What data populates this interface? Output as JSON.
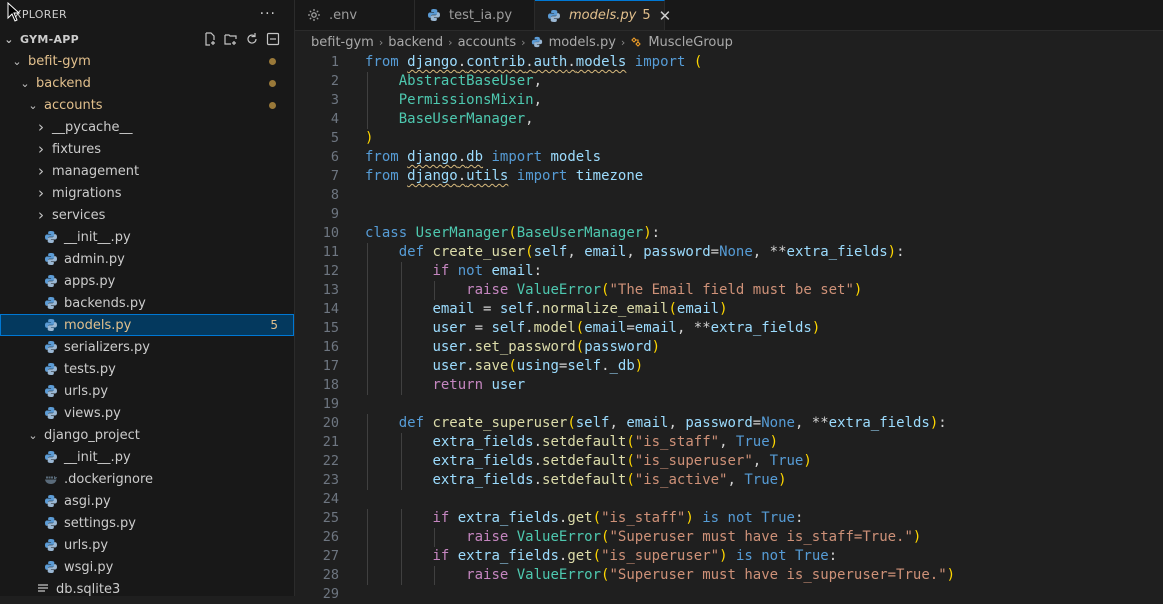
{
  "explorer": {
    "title": "XPLORER",
    "more_label": "···",
    "root": "GYM-APP",
    "items": [
      {
        "label": "befit-gym",
        "kind": "folder",
        "open": true,
        "depth": 1,
        "modified": true
      },
      {
        "label": "backend",
        "kind": "folder",
        "open": true,
        "depth": 2,
        "modified": true
      },
      {
        "label": "accounts",
        "kind": "folder",
        "open": true,
        "depth": 3,
        "modified": true
      },
      {
        "label": "__pycache__",
        "kind": "folder",
        "open": false,
        "depth": 4
      },
      {
        "label": "fixtures",
        "kind": "folder",
        "open": false,
        "depth": 4
      },
      {
        "label": "management",
        "kind": "folder",
        "open": false,
        "depth": 4
      },
      {
        "label": "migrations",
        "kind": "folder",
        "open": false,
        "depth": 4
      },
      {
        "label": "services",
        "kind": "folder",
        "open": false,
        "depth": 4
      },
      {
        "label": "__init__.py",
        "kind": "py",
        "depth": 4
      },
      {
        "label": "admin.py",
        "kind": "py",
        "depth": 4
      },
      {
        "label": "apps.py",
        "kind": "py",
        "depth": 4
      },
      {
        "label": "backends.py",
        "kind": "py",
        "depth": 4
      },
      {
        "label": "models.py",
        "kind": "py",
        "depth": 4,
        "selected": true,
        "badge": "5"
      },
      {
        "label": "serializers.py",
        "kind": "py",
        "depth": 4
      },
      {
        "label": "tests.py",
        "kind": "py",
        "depth": 4
      },
      {
        "label": "urls.py",
        "kind": "py",
        "depth": 4
      },
      {
        "label": "views.py",
        "kind": "py",
        "depth": 4
      },
      {
        "label": "django_project",
        "kind": "folder",
        "open": true,
        "depth": 3
      },
      {
        "label": "__init__.py",
        "kind": "py",
        "depth": 4
      },
      {
        "label": ".dockerignore",
        "kind": "docker",
        "depth": 4
      },
      {
        "label": "asgi.py",
        "kind": "py",
        "depth": 4
      },
      {
        "label": "settings.py",
        "kind": "py",
        "depth": 4
      },
      {
        "label": "urls.py",
        "kind": "py",
        "depth": 4
      },
      {
        "label": "wsgi.py",
        "kind": "py",
        "depth": 4
      },
      {
        "label": "db.sqlite3",
        "kind": "db",
        "depth": 3
      }
    ]
  },
  "tabs": [
    {
      "label": ".env",
      "icon": "gear-icon"
    },
    {
      "label": "test_ia.py",
      "icon": "python-icon"
    },
    {
      "label": "models.py",
      "icon": "python-icon",
      "active": true,
      "count": "5",
      "close": "✕"
    }
  ],
  "breadcrumb": {
    "parts": [
      "befit-gym",
      "backend",
      "accounts",
      "models.py",
      "MuscleGroup"
    ],
    "separator": "›"
  },
  "editor": {
    "line_numbers": [
      "1",
      "2",
      "3",
      "4",
      "5",
      "6",
      "7",
      "8",
      "9",
      "10",
      "11",
      "12",
      "13",
      "14",
      "15",
      "16",
      "17",
      "18",
      "19",
      "20",
      "21",
      "22",
      "23",
      "24",
      "25",
      "26",
      "27",
      "28",
      "29"
    ],
    "lines": [
      "from django.contrib.auth.models import (",
      "    AbstractBaseUser,",
      "    PermissionsMixin,",
      "    BaseUserManager,",
      ")",
      "from django.db import models",
      "from django.utils import timezone",
      "",
      "",
      "class UserManager(BaseUserManager):",
      "    def create_user(self, email, password=None, **extra_fields):",
      "        if not email:",
      "            raise ValueError(\"The Email field must be set\")",
      "        email = self.normalize_email(email)",
      "        user = self.model(email=email, **extra_fields)",
      "        user.set_password(password)",
      "        user.save(using=self._db)",
      "        return user",
      "",
      "    def create_superuser(self, email, password=None, **extra_fields):",
      "        extra_fields.setdefault(\"is_staff\", True)",
      "        extra_fields.setdefault(\"is_superuser\", True)",
      "        extra_fields.setdefault(\"is_active\", True)",
      "",
      "        if extra_fields.get(\"is_staff\") is not True:",
      "            raise ValueError(\"Superuser must have is_staff=True.\")",
      "        if extra_fields.get(\"is_superuser\") is not True:",
      "            raise ValueError(\"Superuser must have is_superuser=True.\")",
      ""
    ]
  },
  "colors": {
    "accent": "#0078d4",
    "modified": "#e2c08d",
    "keyword": "#569cd6",
    "control": "#c586c0",
    "class": "#4ec9b0",
    "function": "#dcdcaa",
    "variable": "#9cdcfe",
    "string": "#ce9178"
  }
}
